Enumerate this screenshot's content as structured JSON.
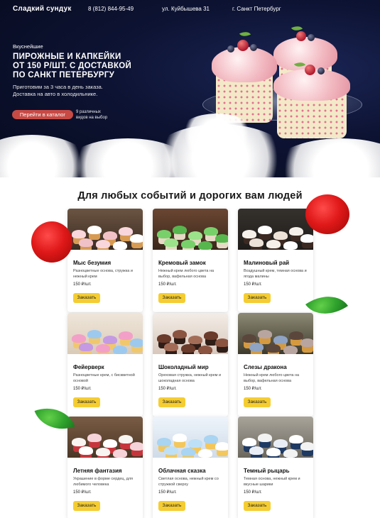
{
  "header": {
    "logo": "Сладкий сундук",
    "phone": "8 (812) 844-95-49",
    "address": "ул. Куйбышева 31",
    "city": "г. Санкт Петербург"
  },
  "hero": {
    "eyebrow": "Вкуснейшие",
    "headline_lines": [
      "Пирожные и капкейки",
      "от 150 р/шт. с доставкой",
      "по Санкт Петербургу"
    ],
    "subtitle_lines": [
      "Приготовим за 3 часа в день заказа.",
      "Доставка на авто в холодильнике."
    ],
    "cta_label": "Перейти в каталог",
    "cta_note_lines": [
      "9 различных",
      "видов на выбор"
    ]
  },
  "section": {
    "title": "Для любых событий и дорогих вам людей"
  },
  "products": [
    {
      "title": "Мыс безумия",
      "desc": "Разноцветные основа, стружка и нежный крем",
      "price": "150 ₽/шт.",
      "order_label": "Заказать"
    },
    {
      "title": "Кремовый замок",
      "desc": "Нежный крем любого цвета на выбор, вафельная основа",
      "price": "150 ₽/шт.",
      "order_label": "Заказать"
    },
    {
      "title": "Малиновый рай",
      "desc": "Воздушный крем, темная основа и ягода малины",
      "price": "150 ₽/шт.",
      "order_label": "Заказать"
    },
    {
      "title": "Фейерверк",
      "desc": "Разноцветные крем, с бисквитной основой",
      "price": "150 ₽/шт.",
      "order_label": "Заказать"
    },
    {
      "title": "Шоколадный мир",
      "desc": "Ореховая стружка, нежный крем и шоколадная основа",
      "price": "150 ₽/шт.",
      "order_label": "Заказать"
    },
    {
      "title": "Слезы дракона",
      "desc": "Нежный крем любого цвета на выбор, вафельная основа",
      "price": "150 ₽/шт.",
      "order_label": "Заказать"
    },
    {
      "title": "Летняя фантазия",
      "desc": "Украшение в форме сердец, для любимого человека",
      "price": "150 ₽/шт.",
      "order_label": "Заказать"
    },
    {
      "title": "Облачная сказка",
      "desc": "Светлая основа, нежный крем со стружкой сверху",
      "price": "150 ₽/шт.",
      "order_label": "Заказать"
    },
    {
      "title": "Темный рыцарь",
      "desc": "Темная основа, нежный крем и вкусные шарики",
      "price": "150 ₽/шт.",
      "order_label": "Заказать"
    }
  ],
  "colors": {
    "hero_bg": "#0d1333",
    "cta": "#c74a45",
    "order_button": "#f5cd32"
  }
}
